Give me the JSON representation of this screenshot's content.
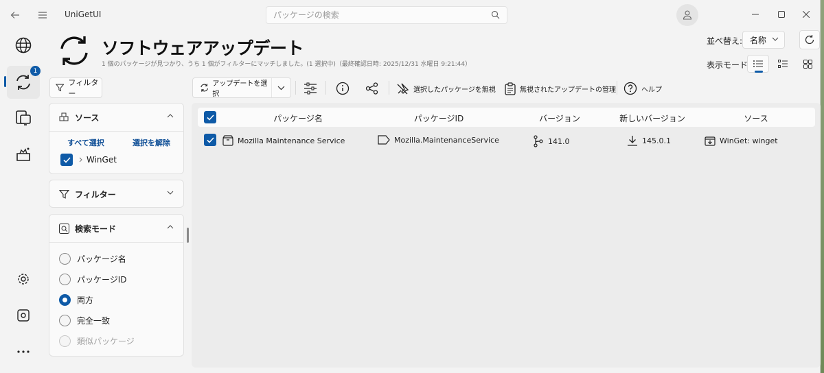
{
  "app": {
    "title": "UniGetUI"
  },
  "search": {
    "placeholder": "パッケージの検索"
  },
  "nav": {
    "updates_badge": "1"
  },
  "header": {
    "title": "ソフトウェアアップデート",
    "subtitle": "1 個のパッケージが見つかり、うち 1 個がフィルターにマッチしました。(1 選択中)（最終確認日時: 2025/12/31 水曜日 9:21:44）",
    "sort_label": "並べ替え:",
    "sort_value": "名称",
    "view_label": "表示モード:"
  },
  "filter_toggle": {
    "label": "フィルター"
  },
  "sources_panel": {
    "title": "ソース",
    "select_all": "すべて選択",
    "deselect": "選択を解除",
    "items": [
      {
        "label": "WinGet",
        "checked": true
      }
    ]
  },
  "filters_panel": {
    "title": "フィルター"
  },
  "search_mode_panel": {
    "title": "検索モード",
    "options": [
      {
        "label": "パッケージ名",
        "selected": false,
        "disabled": false
      },
      {
        "label": "パッケージID",
        "selected": false,
        "disabled": false
      },
      {
        "label": "両方",
        "selected": true,
        "disabled": false
      },
      {
        "label": "完全一致",
        "selected": false,
        "disabled": false
      },
      {
        "label": "類似パッケージ",
        "selected": false,
        "disabled": true
      }
    ]
  },
  "toolbar": {
    "select_update": "アップデートを選択",
    "ignore_selected": "選択したパッケージを無視",
    "manage_ignored": "無視されたアップデートの管理",
    "help": "ヘルプ"
  },
  "table": {
    "columns": [
      "パッケージ名",
      "パッケージID",
      "バージョン",
      "新しいバージョン",
      "ソース"
    ],
    "rows": [
      {
        "name": "Mozilla Maintenance Service",
        "id": "Mozilla.MaintenanceService",
        "version": "141.0",
        "new_version": "145.0.1",
        "source": "WinGet: winget",
        "checked": true
      }
    ]
  },
  "colors": {
    "accent": "#0e5aa7",
    "background": "#f3f3f3"
  }
}
